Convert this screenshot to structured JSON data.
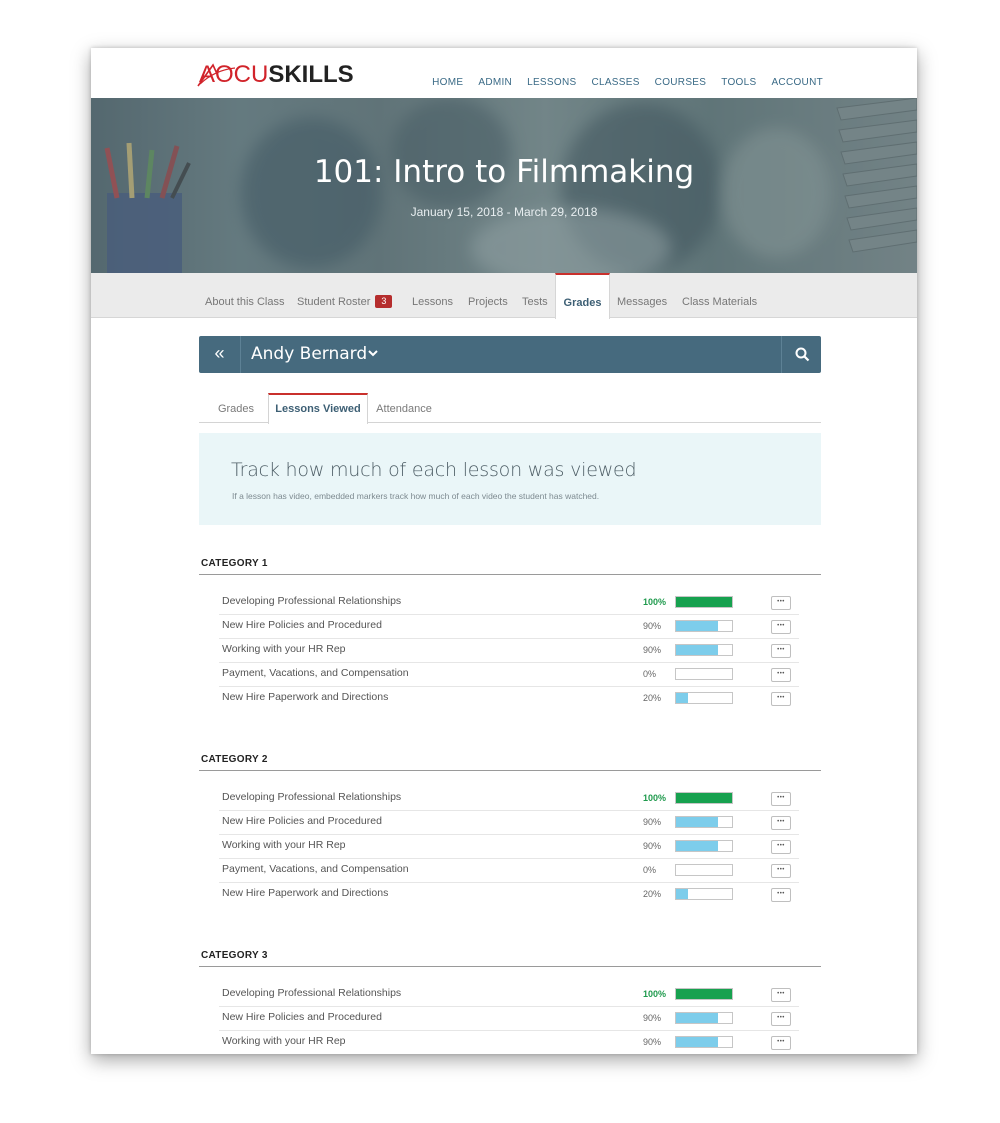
{
  "brand": {
    "accent": "AOCU",
    "bold": "SKILLS"
  },
  "nav": [
    "HOME",
    "ADMIN",
    "LESSONS",
    "CLASSES",
    "COURSES",
    "TOOLS",
    "ACCOUNT"
  ],
  "hero": {
    "title": "101: Intro to Filmmaking",
    "dates": "January 15, 2018 - March 29, 2018"
  },
  "class_tabs": [
    {
      "label": "About this Class"
    },
    {
      "label": "Student Roster",
      "badge": "3"
    },
    {
      "label": "Lessons"
    },
    {
      "label": "Projects"
    },
    {
      "label": "Tests"
    },
    {
      "label": "Grades",
      "active": true
    },
    {
      "label": "Messages"
    },
    {
      "label": "Class Materials"
    }
  ],
  "student": {
    "back_icon": "«",
    "name": "Andy Bernard"
  },
  "sub_tabs": [
    {
      "label": "Grades"
    },
    {
      "label": "Lessons Viewed",
      "active": true
    },
    {
      "label": "Attendance"
    }
  ],
  "info": {
    "title": "Track how much of each lesson was viewed",
    "subtitle": "If a lesson has video, embedded markers track how much of each video the student has watched."
  },
  "categories": [
    {
      "title": "CATEGORY 1",
      "lessons": [
        {
          "title": "Developing Professional Relationships",
          "percent": "100%",
          "value": 100
        },
        {
          "title": "New Hire Policies and Procedured",
          "percent": "90%",
          "value": 75
        },
        {
          "title": "Working with your HR Rep",
          "percent": "90%",
          "value": 75
        },
        {
          "title": "Payment, Vacations, and Compensation",
          "percent": "0%",
          "value": 0
        },
        {
          "title": "New Hire Paperwork and Directions",
          "percent": "20%",
          "value": 22
        }
      ]
    },
    {
      "title": "CATEGORY 2",
      "lessons": [
        {
          "title": "Developing Professional Relationships",
          "percent": "100%",
          "value": 100
        },
        {
          "title": "New Hire Policies and Procedured",
          "percent": "90%",
          "value": 75
        },
        {
          "title": "Working with your HR Rep",
          "percent": "90%",
          "value": 75
        },
        {
          "title": "Payment, Vacations, and Compensation",
          "percent": "0%",
          "value": 0
        },
        {
          "title": "New Hire Paperwork and Directions",
          "percent": "20%",
          "value": 22
        }
      ]
    },
    {
      "title": "CATEGORY 3",
      "lessons": [
        {
          "title": "Developing Professional Relationships",
          "percent": "100%",
          "value": 100
        },
        {
          "title": "New Hire Policies and Procedured",
          "percent": "90%",
          "value": 75
        },
        {
          "title": "Working with your HR Rep",
          "percent": "90%",
          "value": 75
        }
      ]
    }
  ],
  "more_button": "•••",
  "icons": {
    "back": "double-chevron-left-icon",
    "dropdown": "chevron-down-icon",
    "search": "search-icon",
    "more": "more-dots-icon"
  },
  "colors": {
    "accent_red": "#c9302c",
    "bar_blue": "#466a7e",
    "progress_full": "#17a14f",
    "progress_partial": "#7dcdeb",
    "info_bg": "#eaf6f8"
  }
}
